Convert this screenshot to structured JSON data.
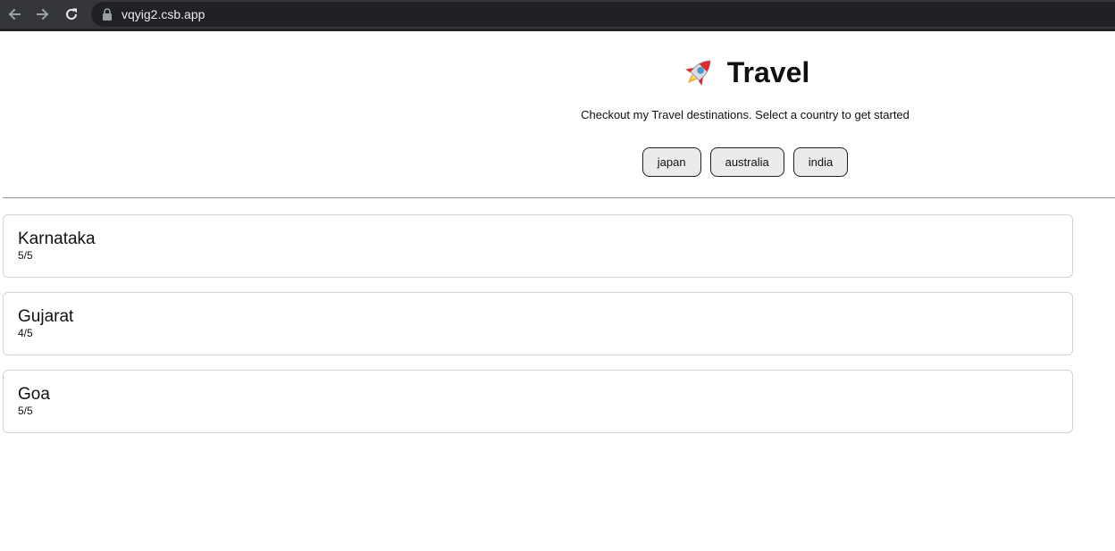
{
  "browser": {
    "url": "vqyig2.csb.app",
    "icons": {
      "back": "arrow-left-icon",
      "forward": "arrow-right-icon",
      "reload": "reload-icon",
      "lock": "lock-icon"
    }
  },
  "header": {
    "icon": "rocket-icon",
    "title": "Travel",
    "subtitle": "Checkout my Travel destinations. Select a country to get started"
  },
  "countries": [
    {
      "label": "japan"
    },
    {
      "label": "australia"
    },
    {
      "label": "india"
    }
  ],
  "places": [
    {
      "name": "Karnataka",
      "rating": "5/5"
    },
    {
      "name": "Gujarat",
      "rating": "4/5"
    },
    {
      "name": "Goa",
      "rating": "5/5"
    }
  ],
  "colors": {
    "browser_bar": "#35363a",
    "omnibox": "#202124",
    "button_bg": "#ebebed",
    "card_border": "#d3d3d3"
  }
}
